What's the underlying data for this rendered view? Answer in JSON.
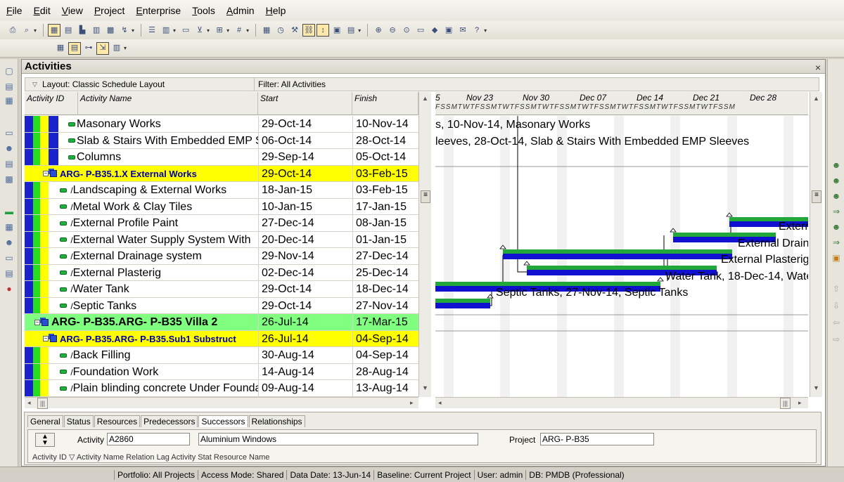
{
  "menu": [
    "File",
    "Edit",
    "View",
    "Project",
    "Enterprise",
    "Tools",
    "Admin",
    "Help"
  ],
  "panel": {
    "title": "Activities",
    "close": "×"
  },
  "layout_bar": {
    "layout": "Layout: Classic Schedule Layout",
    "filter": "Filter: All Activities"
  },
  "columns": {
    "id": "Activity ID",
    "name": "Activity Name",
    "start": "Start",
    "finish": "Finish"
  },
  "rows": [
    {
      "type": "activity",
      "name": "Masonary Works",
      "start": "29-Oct-14",
      "finish": "10-Nov-14"
    },
    {
      "type": "activity",
      "name": "Slab & Stairs With Embedded EMP S",
      "start": "06-Oct-14",
      "finish": "28-Oct-14"
    },
    {
      "type": "activity",
      "name": "Columns",
      "start": "29-Sep-14",
      "finish": "05-Oct-14"
    },
    {
      "type": "wbs-yellow",
      "name": "ARG- P-B35.1.X  External Works",
      "start": "29-Oct-14",
      "finish": "03-Feb-15"
    },
    {
      "type": "activity",
      "name": "Landscaping & External Works",
      "start": "18-Jan-15",
      "finish": "03-Feb-15"
    },
    {
      "type": "activity",
      "name": "Metal Work & Clay Tiles",
      "start": "10-Jan-15",
      "finish": "17-Jan-15"
    },
    {
      "type": "activity",
      "name": "External Profile Paint",
      "start": "27-Dec-14",
      "finish": "08-Jan-15"
    },
    {
      "type": "activity",
      "name": "External Water Supply System With",
      "start": "20-Dec-14",
      "finish": "01-Jan-15"
    },
    {
      "type": "activity",
      "name": "External Drainage system",
      "start": "29-Nov-14",
      "finish": "27-Dec-14"
    },
    {
      "type": "activity",
      "name": "External Plasterig",
      "start": "02-Dec-14",
      "finish": "25-Dec-14"
    },
    {
      "type": "activity",
      "name": "Water Tank",
      "start": "29-Oct-14",
      "finish": "18-Dec-14"
    },
    {
      "type": "activity",
      "name": "Septic Tanks",
      "start": "29-Oct-14",
      "finish": "27-Nov-14"
    },
    {
      "type": "wbs-green",
      "name": "ARG- P-B35.ARG- P-B35  Villa 2",
      "start": "26-Jul-14",
      "finish": "17-Mar-15"
    },
    {
      "type": "wbs-yellow",
      "name": "ARG- P-B35.ARG- P-B35.Sub1  Substruct",
      "start": "26-Jul-14",
      "finish": "04-Sep-14"
    },
    {
      "type": "activity",
      "name": "Back Filling",
      "start": "30-Aug-14",
      "finish": "04-Sep-14"
    },
    {
      "type": "activity",
      "name": "Foundation Work",
      "start": "14-Aug-14",
      "finish": "28-Aug-14"
    },
    {
      "type": "activity",
      "name": "Plain blinding concrete Under Founda",
      "start": "09-Aug-14",
      "finish": "13-Aug-14"
    }
  ],
  "gantt": {
    "weeks": [
      "Nov 23",
      "Nov 30",
      "Dec 07",
      "Dec 14",
      "Dec 21",
      "Dec 28"
    ],
    "first_partial": "5",
    "day_letters": "FSSMTWTFSSMTWTFSSMTWTFSSMTWTFSSMTWTFSSMTWTFSSMTWTFSSM",
    "labels": [
      "s, 10-Nov-14, Masonary Works",
      "leeves, 28-Oct-14, Slab & Stairs With Embedded EMP Sleeves",
      "Extern",
      "External Draina",
      "External Plasterig,",
      "Water Tank, 18-Dec-14, Wate",
      "Septic Tanks, 27-Nov-14, Septic Tanks"
    ],
    "bar_colors": {
      "top": "#22a83a",
      "bottom": "#1010d0"
    }
  },
  "bottom": {
    "tabs": [
      "General",
      "Status",
      "Resources",
      "Predecessors",
      "Successors",
      "Relationships"
    ],
    "activity_label": "Activity",
    "activity_id": "A2860",
    "activity_name": "Aluminium Windows",
    "project_label": "Project",
    "project_id": "ARG- P-B35",
    "sub_header": "Activity ID   ▽ Activity Name                                           Relation                    Lag  Activity Stat  Resource Name"
  },
  "status": [
    "Portfolio: All Projects",
    "Access Mode: Shared",
    "Data Date: 13-Jun-14",
    "Baseline: Current Project",
    "User: admin",
    "DB: PMDB (Professional)"
  ]
}
